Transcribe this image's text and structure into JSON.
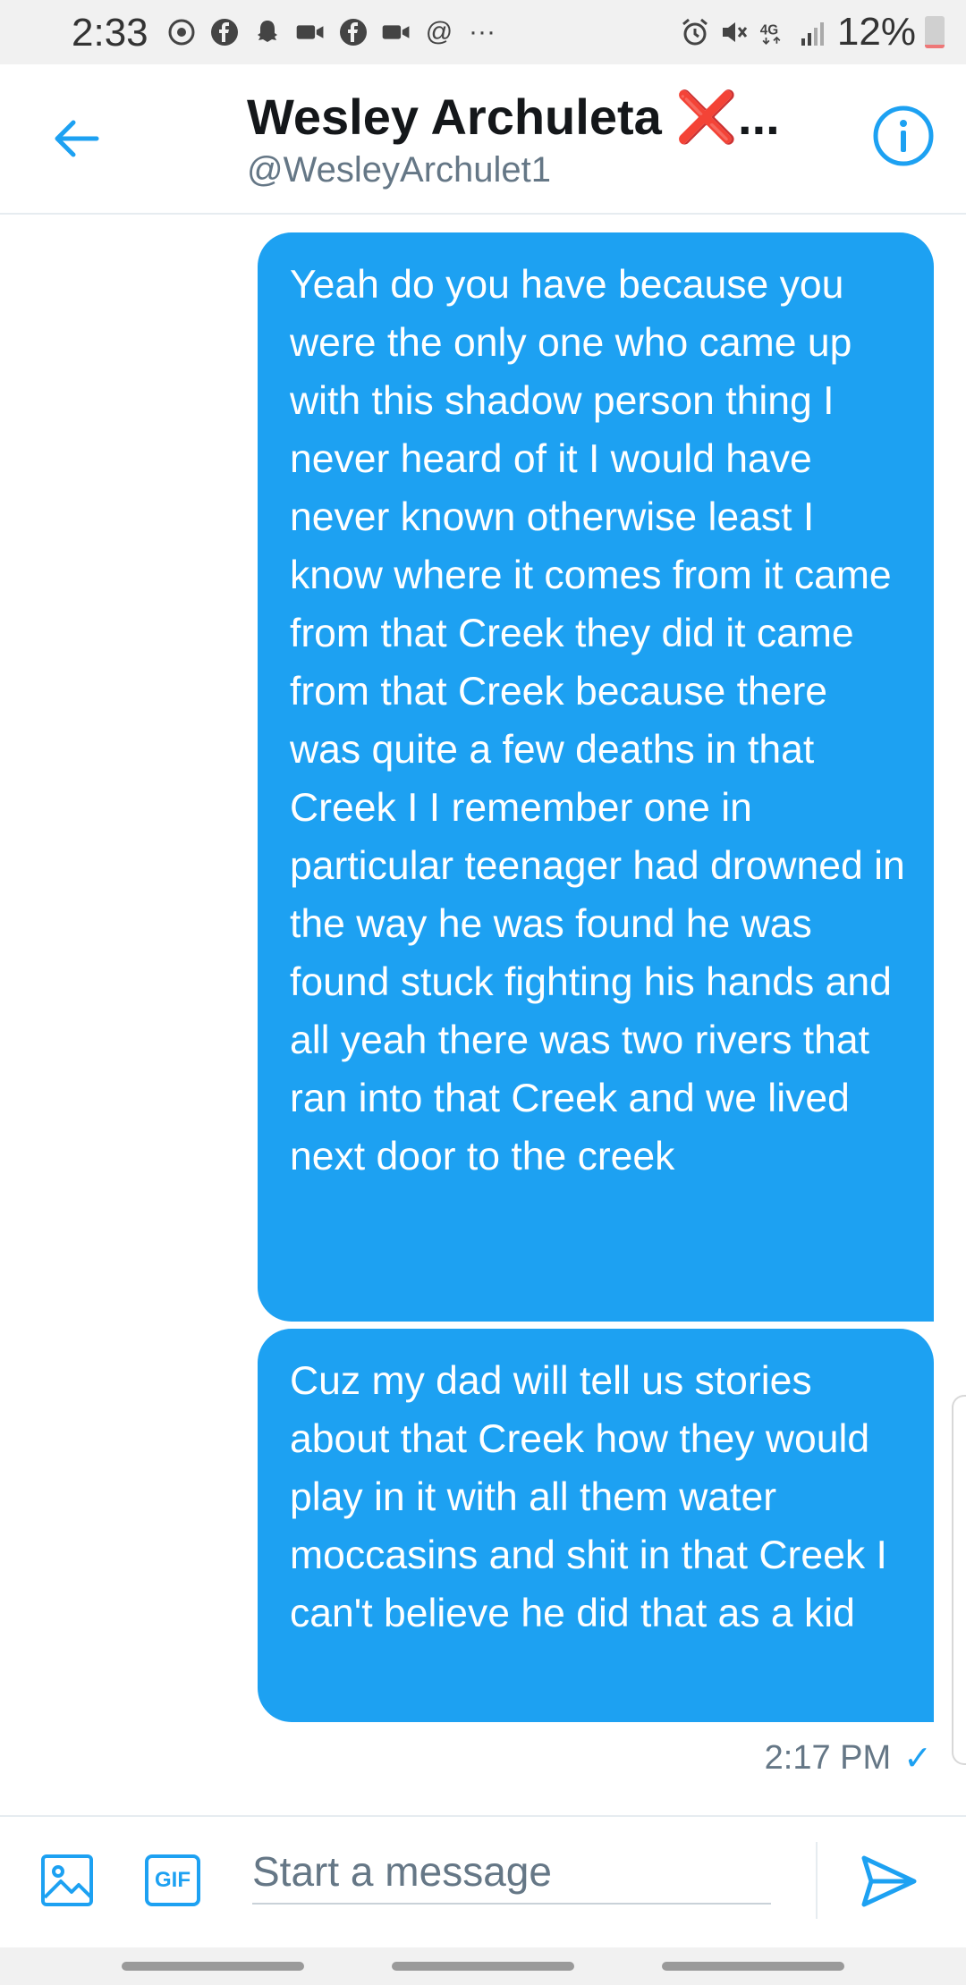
{
  "status_bar": {
    "time": "2:33",
    "battery": "12%",
    "left_icons": [
      "sync-icon",
      "facebook-icon",
      "snapchat-icon",
      "video-icon",
      "facebook-icon",
      "video-icon",
      "at-icon",
      "more-icon"
    ],
    "right_icons": [
      "alarm-icon",
      "mute-icon",
      "4g-lte-icon",
      "signal-icon",
      "battery-icon"
    ],
    "at_symbol": "@",
    "more_symbol": "···"
  },
  "header": {
    "name": "Wesley Archuleta",
    "name_mark": "❌",
    "name_ellipsis": "...",
    "handle": "@WesleyArchulet1"
  },
  "messages": [
    {
      "text": "Yeah do you have because you were the only one who came up with this shadow person thing I never heard of it I would have never known otherwise least I know where it comes from it came from that Creek they did it came from that Creek because there was quite a few deaths in that Creek I I remember one in particular teenager had drowned in the way he was found he was found stuck fighting his hands and all yeah there was two rivers that ran into that Creek and we lived next door to the creek"
    },
    {
      "text": "Cuz my dad will tell us stories about that Creek how they would play in it with all them water moccasins and shit in that Creek I can't believe he did that as a kid"
    }
  ],
  "last_message_time": "2:17 PM",
  "read_mark": "✓",
  "composer": {
    "gif_label": "GIF",
    "placeholder": "Start a message"
  },
  "colors": {
    "accent": "#1da1f2",
    "bubble_text": "#ffffff",
    "secondary_text": "#657786"
  }
}
